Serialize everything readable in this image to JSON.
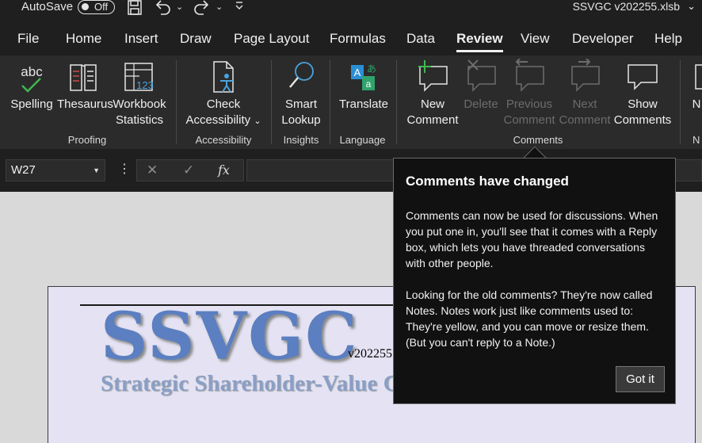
{
  "titlebar": {
    "autosave_label": "AutoSave",
    "autosave_state": "Off",
    "filename": "SSVGC v202255.xlsb",
    "icons": [
      "save-icon",
      "undo-icon",
      "redo-icon",
      "customize-qat-icon"
    ]
  },
  "tabs": [
    {
      "label": "File"
    },
    {
      "label": "Home"
    },
    {
      "label": "Insert"
    },
    {
      "label": "Draw"
    },
    {
      "label": "Page Layout"
    },
    {
      "label": "Formulas"
    },
    {
      "label": "Data"
    },
    {
      "label": "Review",
      "active": true
    },
    {
      "label": "View"
    },
    {
      "label": "Developer"
    },
    {
      "label": "Help"
    }
  ],
  "ribbon": {
    "proofing": {
      "group_label": "Proofing",
      "spelling": {
        "label": "Spelling",
        "icon_text": "abc"
      },
      "thesaurus": {
        "label": "Thesaurus"
      },
      "workbook_stats": {
        "line1": "Workbook",
        "line2": "Statistics",
        "icon_text": "123"
      }
    },
    "accessibility": {
      "group_label": "Accessibility",
      "check": {
        "line1": "Check",
        "line2": "Accessibility"
      }
    },
    "insights": {
      "group_label": "Insights",
      "smart_lookup": {
        "line1": "Smart",
        "line2": "Lookup"
      }
    },
    "language": {
      "group_label": "Language",
      "translate": {
        "label": "Translate"
      }
    },
    "comments": {
      "group_label": "Comments",
      "new": {
        "line1": "New",
        "line2": "Comment"
      },
      "delete": {
        "label": "Delete"
      },
      "previous": {
        "line1": "Previous",
        "line2": "Comment"
      },
      "next": {
        "line1": "Next",
        "line2": "Comment"
      },
      "show": {
        "line1": "Show",
        "line2": "Comments"
      }
    },
    "overflow_partial": "N"
  },
  "formula_bar": {
    "name_box": "W27",
    "cancel": "✕",
    "enter": "✓",
    "fx": "fx",
    "formula": ""
  },
  "sheet": {
    "logo": "SSVGC",
    "version": "v202255",
    "tagline": "Strategic Shareholder-Value G"
  },
  "popup": {
    "title": "Comments have changed",
    "p1": "Comments can now be used for discussions. When you put one in, you'll see that it comes with a Reply box, which lets you have threaded conversations with other people.",
    "p2": "Looking for the old comments? They're now called Notes. Notes work just like comments used to: They're yellow, and you can move or resize them. (But you can't reply to a Note.)",
    "button": "Got it"
  },
  "colors": {
    "chrome_dark": "#1f1f1f",
    "ribbon_bg": "#2b2b2b",
    "popup_bg": "#111111",
    "logo_blue": "#5b7fc0",
    "sheet_bg": "#e5e3f3",
    "spelling_check_green": "#3fb950",
    "excel_blue": "#4aa3df"
  }
}
